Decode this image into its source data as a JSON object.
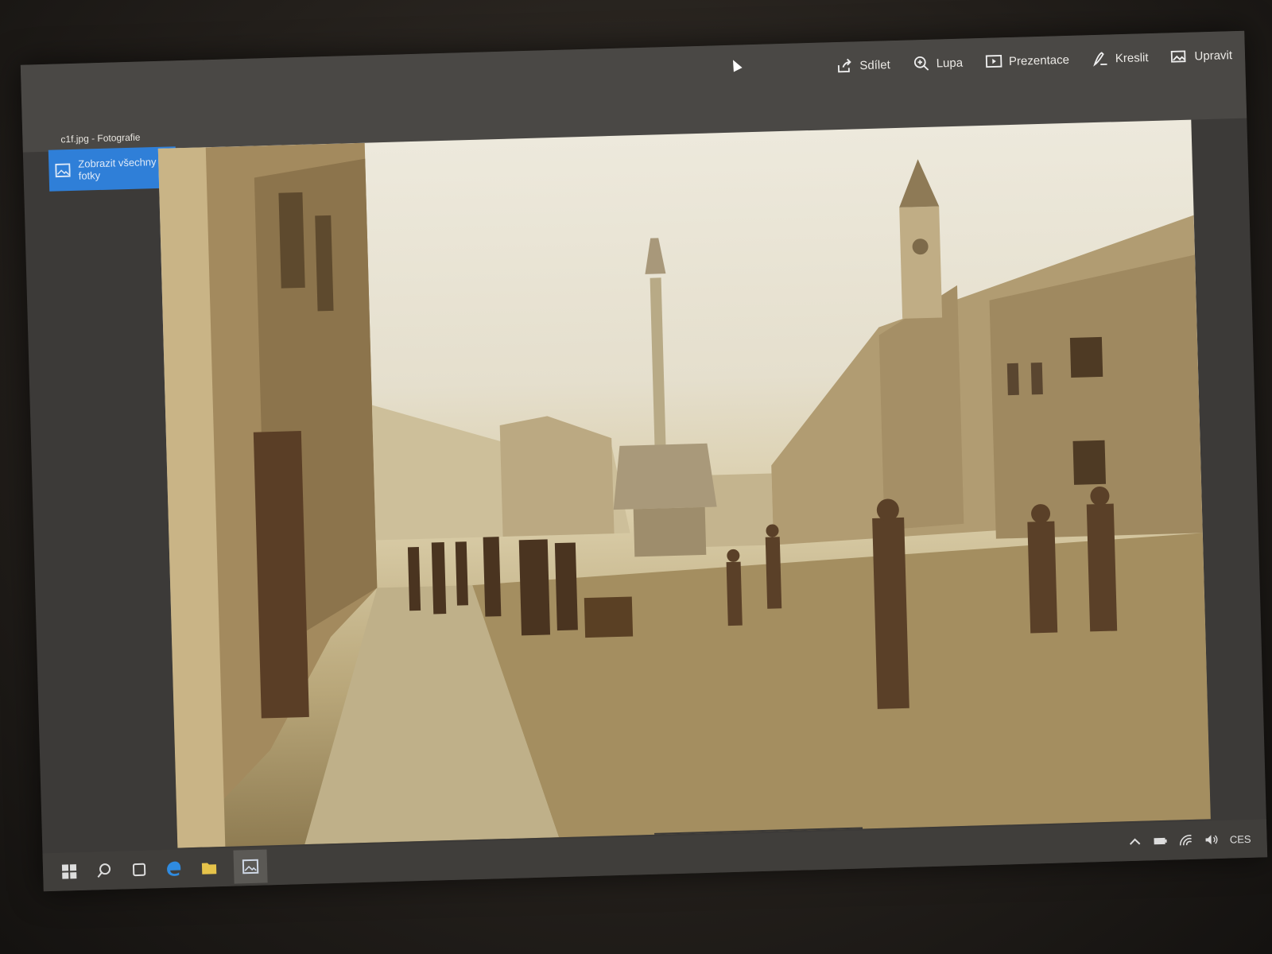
{
  "window": {
    "title": "c1f.jpg - Fotografie"
  },
  "toolbar": {
    "share_label": "Sdílet",
    "zoom_label": "Lupa",
    "slideshow_label": "Prezentace",
    "draw_label": "Kreslit",
    "edit_label": "Upravit"
  },
  "sidebar": {
    "show_all_label": "Zobrazit všechny fotky"
  },
  "taskbar": {
    "language": "CES"
  },
  "colors": {
    "accent": "#2f7fd8",
    "chrome": "#3c3a38",
    "sepia": "#d9cca7"
  }
}
